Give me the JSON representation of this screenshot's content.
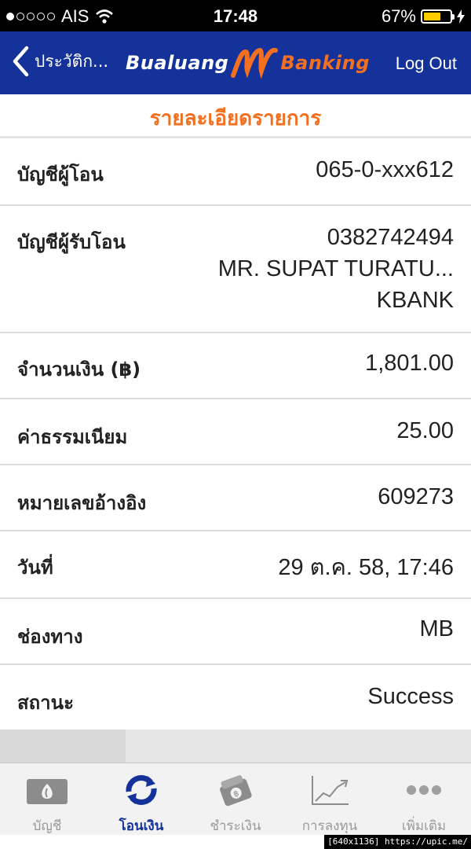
{
  "status_bar": {
    "carrier": "AIS",
    "time": "17:48",
    "battery_percent_label": "67%",
    "battery_level": 0.67,
    "signal_bars_filled": 1,
    "signal_bars_total": 5
  },
  "header": {
    "back_label": "ประวัติก...",
    "logo_part1": "Bualuang",
    "logo_part2": "Banking",
    "logout_label": "Log Out",
    "colors": {
      "background": "#14329a",
      "accent": "#f37021"
    }
  },
  "page_title": "รายละเอียดรายการ",
  "details": [
    {
      "label": "บัญชีผู้โอน",
      "values": [
        "065-0-xxx612"
      ]
    },
    {
      "label": "บัญชีผู้รับโอน",
      "values": [
        "0382742494",
        "MR. SUPAT TURATU...",
        "KBANK"
      ]
    },
    {
      "label": "จำนวนเงิน (฿)",
      "values": [
        "1,801.00"
      ]
    },
    {
      "label": "ค่าธรรมเนียม",
      "values": [
        "25.00"
      ]
    },
    {
      "label": "หมายเลขอ้างอิง",
      "values": [
        "609273"
      ]
    },
    {
      "label": "วันที่",
      "values": [
        "29 ต.ค. 58, 17:46"
      ]
    },
    {
      "label": "ช่องทาง",
      "values": [
        "MB"
      ]
    },
    {
      "label": "สถานะ",
      "values": [
        "Success"
      ]
    }
  ],
  "tabs": [
    {
      "label": "บัญชี",
      "icon": "account-card-icon",
      "active": false
    },
    {
      "label": "โอนเงิน",
      "icon": "transfer-refresh-icon",
      "active": true
    },
    {
      "label": "ชำระเงิน",
      "icon": "payment-wallet-icon",
      "active": false
    },
    {
      "label": "การลงทุน",
      "icon": "investment-chart-icon",
      "active": false
    },
    {
      "label": "เพิ่มเติม",
      "icon": "more-dots-icon",
      "active": false
    }
  ],
  "watermark": "[640x1136] https://upic.me/"
}
